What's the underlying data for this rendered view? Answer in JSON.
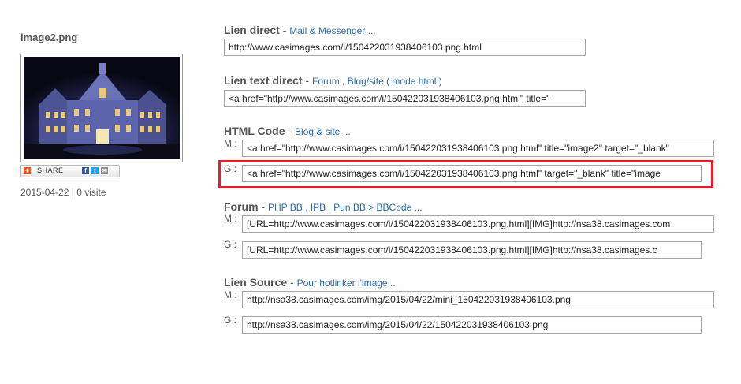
{
  "image": {
    "filename": "image2.png",
    "date": "2015-04-22",
    "separator": "|",
    "visits": "0 visite",
    "share_label": "SHARE"
  },
  "icons": [
    "addthis-plus-icon",
    "facebook-icon",
    "twitter-icon",
    "email-icon"
  ],
  "sections": {
    "lien_direct": {
      "title": "Lien direct",
      "dash": "-",
      "sub": "Mail & Messenger ...",
      "value": "http://www.casimages.com/i/150422031938406103.png.html"
    },
    "lien_text_direct": {
      "title": "Lien text direct",
      "dash": "-",
      "sub": "Forum , Blog/site ( mode html )",
      "value": "<a href=\"http://www.casimages.com/i/150422031938406103.png.html\" title=\""
    },
    "html_code": {
      "title": "HTML Code",
      "dash": "-",
      "sub": "Blog & site ...",
      "m_label": "M :",
      "m_value": "<a href=\"http://www.casimages.com/i/150422031938406103.png.html\" title=\"image2\" target=\"_blank\"",
      "g_label": "G :",
      "g_value": "<a href=\"http://www.casimages.com/i/150422031938406103.png.html\" target=\"_blank\" title=\"image"
    },
    "forum": {
      "title": "Forum",
      "dash": "-",
      "sub": "PHP BB , IPB , Pun BB > BBCode ...",
      "m_label": "M :",
      "m_value": "[URL=http://www.casimages.com/i/150422031938406103.png.html][IMG]http://nsa38.casimages.com",
      "g_label": "G :",
      "g_value": "[URL=http://www.casimages.com/i/150422031938406103.png.html][IMG]http://nsa38.casimages.c"
    },
    "lien_source": {
      "title": "Lien Source",
      "dash": "-",
      "sub": "Pour hotlinker l'image ...",
      "m_label": "M :",
      "m_value": "http://nsa38.casimages.com/img/2015/04/22/mini_150422031938406103.png",
      "g_label": "G :",
      "g_value": "http://nsa38.casimages.com/img/2015/04/22/150422031938406103.png"
    }
  },
  "colors": {
    "highlight": "#e0202a",
    "link": "#2a6db0"
  }
}
